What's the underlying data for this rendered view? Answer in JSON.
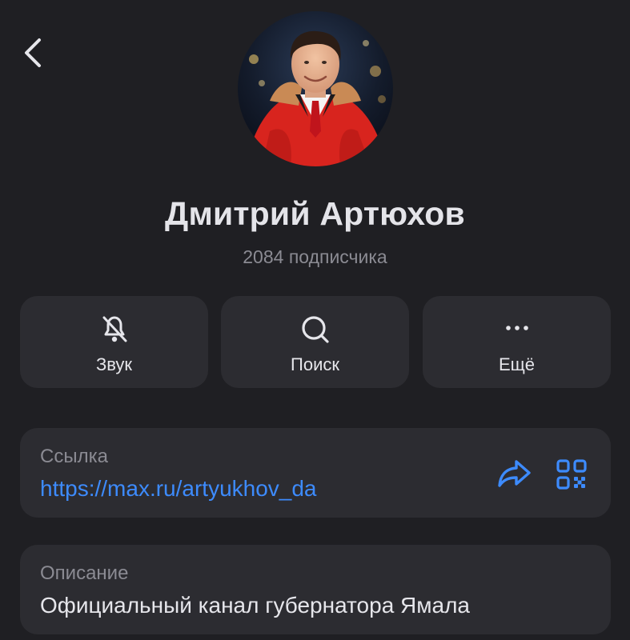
{
  "profile": {
    "name": "Дмитрий Артюхов",
    "subscribers": "2084 подписчика"
  },
  "actions": [
    {
      "label": "Звук",
      "icon": "bell-off-icon"
    },
    {
      "label": "Поиск",
      "icon": "search-icon"
    },
    {
      "label": "Ещё",
      "icon": "more-dots-icon"
    }
  ],
  "link_card": {
    "caption": "Ссылка",
    "value": "https://max.ru/artyukhov_da"
  },
  "description_card": {
    "caption": "Описание",
    "value": "Официальный канал губернатора Ямала"
  },
  "colors": {
    "background": "#1f1f23",
    "card": "#2c2c31",
    "accent": "#3d8bfd",
    "muted_text": "#8b8b93"
  }
}
